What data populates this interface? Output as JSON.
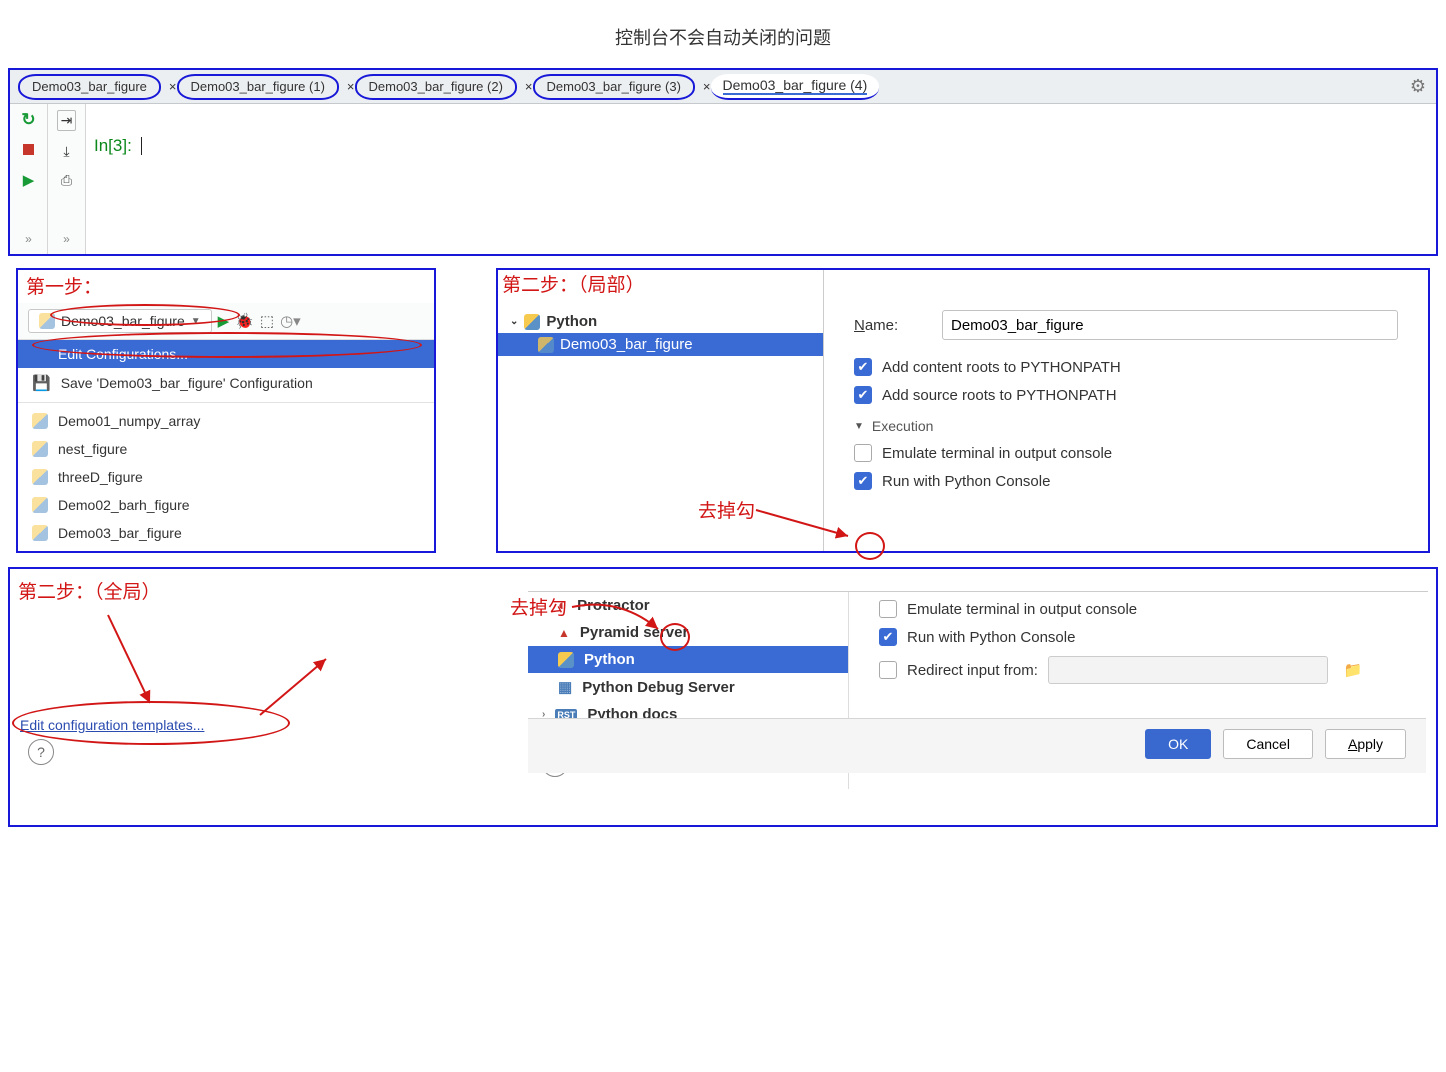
{
  "page_title": "控制台不会自动关闭的问题",
  "tabs": [
    "Demo03_bar_figure",
    "Demo03_bar_figure (1)",
    "Demo03_bar_figure (2)",
    "Demo03_bar_figure (3)",
    "Demo03_bar_figure (4)"
  ],
  "active_tab": 4,
  "prompt": "In[3]: ",
  "step1": {
    "label": "第一步：",
    "selected_config": "Demo03_bar_figure",
    "edit_item": "Edit Configurations...",
    "save_item": "Save 'Demo03_bar_figure' Configuration",
    "configs": [
      "Demo01_numpy_array",
      "nest_figure",
      "threeD_figure",
      "Demo02_barh_figure",
      "Demo03_bar_figure"
    ]
  },
  "step2_local": {
    "label": "第二步：（局部）",
    "tree_root": "Python",
    "tree_item": "Demo03_bar_figure",
    "name_label": "Name:",
    "name_value": "Demo03_bar_figure",
    "add_content": "Add content roots to PYTHONPATH",
    "add_source": "Add source roots to PYTHONPATH",
    "execution": "Execution",
    "emulate": "Emulate terminal in output console",
    "run_console": "Run with Python Console",
    "anno": "去掉勾"
  },
  "step2_global": {
    "label": "第二步：（全局）",
    "anno": "去掉勾",
    "link": "Edit configuration templates...",
    "list": [
      "Protractor",
      "Pyramid server",
      "Python",
      "Python Debug Server",
      "Python docs"
    ],
    "selected": 2,
    "emulate": "Emulate terminal in output console",
    "run_console": "Run with Python Console",
    "redirect": "Redirect input from:",
    "ok": "OK",
    "cancel": "Cancel",
    "apply": "Apply"
  }
}
